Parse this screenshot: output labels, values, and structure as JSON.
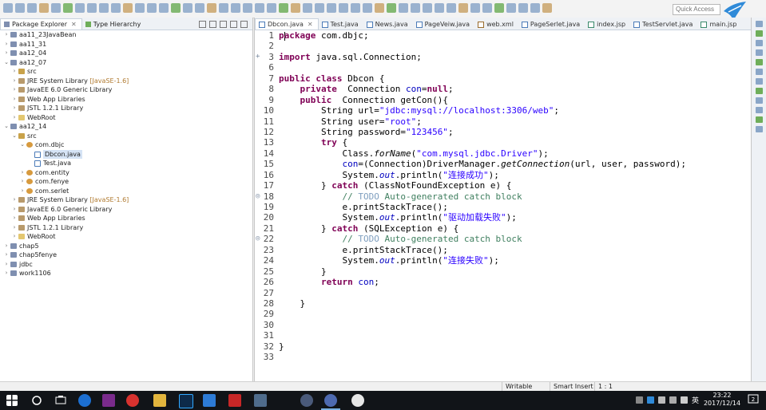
{
  "toolbar": {
    "quick_access_placeholder": "Quick Access"
  },
  "left_panel": {
    "tabs": [
      {
        "label": "Package Explorer",
        "active": true
      },
      {
        "label": "Type Hierarchy",
        "active": false
      }
    ],
    "tree": [
      {
        "label": "aa11_23JavaBean",
        "depth": 0,
        "expanded": false,
        "icon": "project-icon"
      },
      {
        "label": "aa11_31",
        "depth": 0,
        "expanded": false,
        "icon": "project-icon"
      },
      {
        "label": "aa12_04",
        "depth": 0,
        "expanded": false,
        "icon": "project-icon"
      },
      {
        "label": "aa12_07",
        "depth": 0,
        "expanded": true,
        "icon": "project-icon"
      },
      {
        "label": "src",
        "depth": 1,
        "expanded": false,
        "icon": "source-folder-icon"
      },
      {
        "label": "JRE System Library",
        "suffix": "[JavaSE-1.6]",
        "depth": 1,
        "expanded": false,
        "icon": "library-icon"
      },
      {
        "label": "JavaEE 6.0 Generic Library",
        "depth": 1,
        "expanded": false,
        "icon": "library-icon"
      },
      {
        "label": "Web App Libraries",
        "depth": 1,
        "expanded": false,
        "icon": "library-icon"
      },
      {
        "label": "JSTL 1.2.1 Library",
        "depth": 1,
        "expanded": false,
        "icon": "library-icon"
      },
      {
        "label": "WebRoot",
        "depth": 1,
        "expanded": false,
        "icon": "folder-icon"
      },
      {
        "label": "aa12_14",
        "depth": 0,
        "expanded": true,
        "icon": "project-icon"
      },
      {
        "label": "src",
        "depth": 1,
        "expanded": true,
        "icon": "source-folder-icon"
      },
      {
        "label": "com.dbjc",
        "depth": 2,
        "expanded": true,
        "icon": "package-icon"
      },
      {
        "label": "Dbcon.java",
        "depth": 3,
        "expanded": false,
        "icon": "java-file-icon",
        "selected": true
      },
      {
        "label": "Test.java",
        "depth": 3,
        "expanded": false,
        "icon": "java-file-icon"
      },
      {
        "label": "com.entity",
        "depth": 2,
        "expanded": false,
        "icon": "package-icon"
      },
      {
        "label": "com.fenye",
        "depth": 2,
        "expanded": false,
        "icon": "package-icon"
      },
      {
        "label": "com.serlet",
        "depth": 2,
        "expanded": false,
        "icon": "package-icon"
      },
      {
        "label": "JRE System Library",
        "suffix": "[JavaSE-1.6]",
        "depth": 1,
        "expanded": false,
        "icon": "library-icon"
      },
      {
        "label": "JavaEE 6.0 Generic Library",
        "depth": 1,
        "expanded": false,
        "icon": "library-icon"
      },
      {
        "label": "Web App Libraries",
        "depth": 1,
        "expanded": false,
        "icon": "library-icon"
      },
      {
        "label": "JSTL 1.2.1 Library",
        "depth": 1,
        "expanded": false,
        "icon": "library-icon"
      },
      {
        "label": "WebRoot",
        "depth": 1,
        "expanded": false,
        "icon": "folder-icon"
      },
      {
        "label": "chap5",
        "depth": 0,
        "expanded": false,
        "icon": "project-icon"
      },
      {
        "label": "chap5fenye",
        "depth": 0,
        "expanded": false,
        "icon": "project-icon"
      },
      {
        "label": "jdbc",
        "depth": 0,
        "expanded": false,
        "icon": "project-icon"
      },
      {
        "label": "work1106",
        "depth": 0,
        "expanded": false,
        "icon": "project-icon"
      }
    ]
  },
  "editor": {
    "tabs": [
      {
        "label": "Dbcon.java",
        "active": true,
        "kind": "java",
        "closable": true
      },
      {
        "label": "Test.java",
        "active": false,
        "kind": "java"
      },
      {
        "label": "News.java",
        "active": false,
        "kind": "java"
      },
      {
        "label": "PageVeiw.java",
        "active": false,
        "kind": "java"
      },
      {
        "label": "web.xml",
        "active": false,
        "kind": "xml"
      },
      {
        "label": "PageSerlet.java",
        "active": false,
        "kind": "java"
      },
      {
        "label": "index.jsp",
        "active": false,
        "kind": "jsp"
      },
      {
        "label": "TestServlet.java",
        "active": false,
        "kind": "java"
      },
      {
        "label": "main.jsp",
        "active": false,
        "kind": "jsp"
      }
    ],
    "line_numbers": [
      "1",
      "2",
      "3",
      "6",
      "7",
      "8",
      "9",
      "10",
      "11",
      "12",
      "13",
      "14",
      "15",
      "16",
      "17",
      "18",
      "19",
      "20",
      "21",
      "22",
      "23",
      "24",
      "25",
      "26",
      "27",
      "28",
      "29",
      "30",
      "31",
      "32",
      "33"
    ],
    "folded_markers": {
      "2": "+",
      "15": "◎",
      "19": "◎"
    },
    "lines": [
      [
        [
          "p",
          "ackage com.dbjc;"
        ],
        [
          "kw",
          "p"
        ]
      ],
      [],
      [
        [
          "kw",
          "import"
        ],
        [
          "p",
          " java.sql.Connection;"
        ]
      ],
      [],
      [
        [
          "kw",
          "public"
        ],
        [
          "p",
          " "
        ],
        [
          "kw",
          "class"
        ],
        [
          "p",
          " Dbcon {"
        ]
      ],
      [
        [
          "p",
          "    "
        ],
        [
          "kw",
          "private"
        ],
        [
          "p",
          "  Connection "
        ],
        [
          "fld",
          "con"
        ],
        [
          "p",
          "="
        ],
        [
          "kw",
          "null"
        ],
        [
          "p",
          ";"
        ]
      ],
      [
        [
          "p",
          "    "
        ],
        [
          "kw",
          "public"
        ],
        [
          "p",
          "  Connection getCon(){"
        ]
      ],
      [
        [
          "p",
          "        String url="
        ],
        [
          "str",
          "\"jdbc:mysql://localhost:3306/web\""
        ],
        [
          "p",
          ";"
        ]
      ],
      [
        [
          "p",
          "        String user="
        ],
        [
          "str",
          "\"root\""
        ],
        [
          "p",
          ";"
        ]
      ],
      [
        [
          "p",
          "        String password="
        ],
        [
          "str",
          "\"123456\""
        ],
        [
          "p",
          ";"
        ]
      ],
      [
        [
          "p",
          "        "
        ],
        [
          "kw",
          "try"
        ],
        [
          "p",
          " {"
        ]
      ],
      [
        [
          "p",
          "            Class."
        ],
        [
          "it",
          "forName"
        ],
        [
          "p",
          "("
        ],
        [
          "str",
          "\"com.mysql.jdbc.Driver\""
        ],
        [
          "p",
          ");"
        ]
      ],
      [
        [
          "p",
          "            "
        ],
        [
          "fld",
          "con"
        ],
        [
          "p",
          "=(Connection)DriverManager."
        ],
        [
          "it",
          "getConnection"
        ],
        [
          "p",
          "(url, user, password);"
        ]
      ],
      [
        [
          "p",
          "            System."
        ],
        [
          "fldit",
          "out"
        ],
        [
          "p",
          ".println("
        ],
        [
          "str",
          "\"连接成功\""
        ],
        [
          "p",
          ");"
        ]
      ],
      [
        [
          "p",
          "        } "
        ],
        [
          "kw",
          "catch"
        ],
        [
          "p",
          " (ClassNotFoundException e) {"
        ]
      ],
      [
        [
          "p",
          "            "
        ],
        [
          "cm",
          "// "
        ],
        [
          "todo",
          "TODO"
        ],
        [
          "cm",
          " Auto-generated catch block"
        ]
      ],
      [
        [
          "p",
          "            e.printStackTrace();"
        ]
      ],
      [
        [
          "p",
          "            System."
        ],
        [
          "fldit",
          "out"
        ],
        [
          "p",
          ".println("
        ],
        [
          "str",
          "\"驱动加载失败\""
        ],
        [
          "p",
          ");"
        ]
      ],
      [
        [
          "p",
          "        } "
        ],
        [
          "kw",
          "catch"
        ],
        [
          "p",
          " (SQLException e) {"
        ]
      ],
      [
        [
          "p",
          "            "
        ],
        [
          "cm",
          "// "
        ],
        [
          "todo",
          "TODO"
        ],
        [
          "cm",
          " Auto-generated catch block"
        ]
      ],
      [
        [
          "p",
          "            e.printStackTrace();"
        ]
      ],
      [
        [
          "p",
          "            System."
        ],
        [
          "fldit",
          "out"
        ],
        [
          "p",
          ".println("
        ],
        [
          "str",
          "\"连接失败\""
        ],
        [
          "p",
          ");"
        ]
      ],
      [
        [
          "p",
          "        }"
        ]
      ],
      [
        [
          "p",
          "        "
        ],
        [
          "kw",
          "return"
        ],
        [
          "p",
          " "
        ],
        [
          "fld",
          "con"
        ],
        [
          "p",
          ";"
        ]
      ],
      [],
      [
        [
          "p",
          "    }"
        ]
      ],
      [],
      [],
      [],
      [
        [
          "p",
          "}"
        ]
      ],
      []
    ]
  },
  "status_bar": {
    "writable": "Writable",
    "insert_mode": "Smart Insert",
    "position": "1 : 1"
  },
  "taskbar": {
    "time": "23:22",
    "date": "2017/12/14",
    "ime": "英"
  }
}
